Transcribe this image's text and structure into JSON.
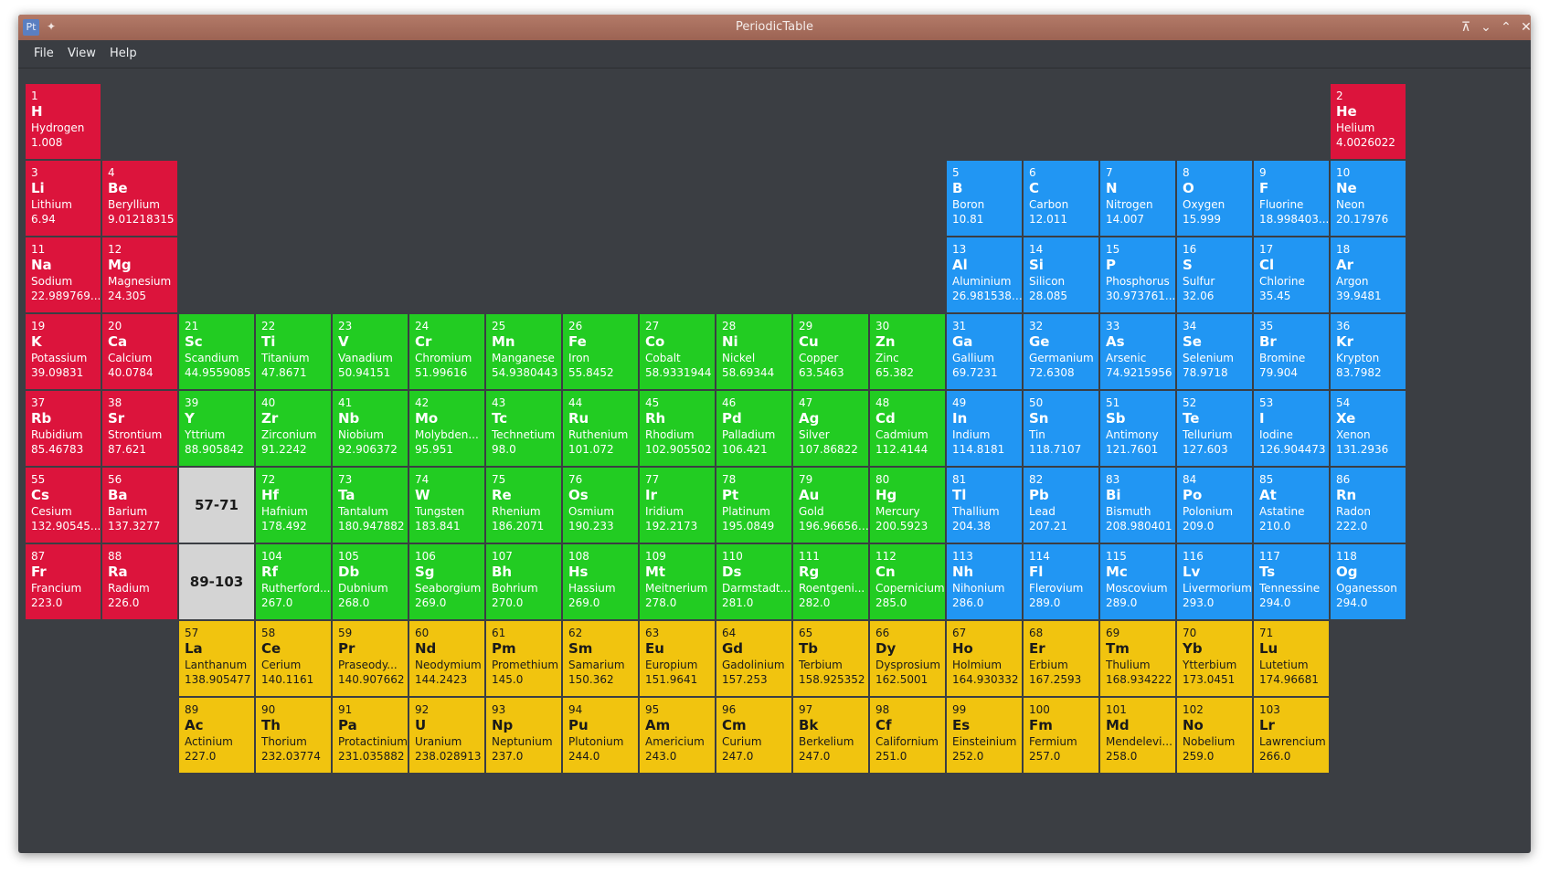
{
  "window": {
    "title": "PeriodicTable",
    "app_icon": "Pt",
    "controls": [
      "keep-above-icon",
      "minimize-icon",
      "maximize-icon",
      "close-icon"
    ]
  },
  "menu": [
    "File",
    "View",
    "Help"
  ],
  "colors": {
    "alkali_group": "#dc143c",
    "transition": "#22cc22",
    "p_block": "#2196f3",
    "f_block": "#f1c40f",
    "placeholder": "#d4d4d4",
    "background": "#3b3e43"
  },
  "placeholders": [
    {
      "label": "57-71",
      "row": 6,
      "col": 3
    },
    {
      "label": "89-103",
      "row": 7,
      "col": 3
    }
  ],
  "elements": [
    {
      "n": "1",
      "s": "H",
      "name": "Hydrogen",
      "m": "1.008",
      "row": 1,
      "col": 1,
      "cat": "alkali"
    },
    {
      "n": "2",
      "s": "He",
      "name": "Helium",
      "m": "4.0026022",
      "row": 1,
      "col": 18,
      "cat": "alkali"
    },
    {
      "n": "3",
      "s": "Li",
      "name": "Lithium",
      "m": "6.94",
      "row": 2,
      "col": 1,
      "cat": "alkali"
    },
    {
      "n": "4",
      "s": "Be",
      "name": "Beryllium",
      "m": "9.01218315",
      "row": 2,
      "col": 2,
      "cat": "alkali"
    },
    {
      "n": "5",
      "s": "B",
      "name": "Boron",
      "m": "10.81",
      "row": 2,
      "col": 13,
      "cat": "pblock"
    },
    {
      "n": "6",
      "s": "C",
      "name": "Carbon",
      "m": "12.011",
      "row": 2,
      "col": 14,
      "cat": "pblock"
    },
    {
      "n": "7",
      "s": "N",
      "name": "Nitrogen",
      "m": "14.007",
      "row": 2,
      "col": 15,
      "cat": "pblock"
    },
    {
      "n": "8",
      "s": "O",
      "name": "Oxygen",
      "m": "15.999",
      "row": 2,
      "col": 16,
      "cat": "pblock"
    },
    {
      "n": "9",
      "s": "F",
      "name": "Fluorine",
      "m": "18.998403...",
      "row": 2,
      "col": 17,
      "cat": "pblock"
    },
    {
      "n": "10",
      "s": "Ne",
      "name": "Neon",
      "m": "20.17976",
      "row": 2,
      "col": 18,
      "cat": "pblock"
    },
    {
      "n": "11",
      "s": "Na",
      "name": "Sodium",
      "m": "22.989769...",
      "row": 3,
      "col": 1,
      "cat": "alkali"
    },
    {
      "n": "12",
      "s": "Mg",
      "name": "Magnesium",
      "m": "24.305",
      "row": 3,
      "col": 2,
      "cat": "alkali"
    },
    {
      "n": "13",
      "s": "Al",
      "name": "Aluminium",
      "m": "26.98153857",
      "row": 3,
      "col": 13,
      "cat": "pblock"
    },
    {
      "n": "14",
      "s": "Si",
      "name": "Silicon",
      "m": "28.085",
      "row": 3,
      "col": 14,
      "cat": "pblock"
    },
    {
      "n": "15",
      "s": "P",
      "name": "Phosphorus",
      "m": "30.973761...",
      "row": 3,
      "col": 15,
      "cat": "pblock"
    },
    {
      "n": "16",
      "s": "S",
      "name": "Sulfur",
      "m": "32.06",
      "row": 3,
      "col": 16,
      "cat": "pblock"
    },
    {
      "n": "17",
      "s": "Cl",
      "name": "Chlorine",
      "m": "35.45",
      "row": 3,
      "col": 17,
      "cat": "pblock"
    },
    {
      "n": "18",
      "s": "Ar",
      "name": "Argon",
      "m": "39.9481",
      "row": 3,
      "col": 18,
      "cat": "pblock"
    },
    {
      "n": "19",
      "s": "K",
      "name": "Potassium",
      "m": "39.09831",
      "row": 4,
      "col": 1,
      "cat": "alkali"
    },
    {
      "n": "20",
      "s": "Ca",
      "name": "Calcium",
      "m": "40.0784",
      "row": 4,
      "col": 2,
      "cat": "alkali"
    },
    {
      "n": "21",
      "s": "Sc",
      "name": "Scandium",
      "m": "44.9559085",
      "row": 4,
      "col": 3,
      "cat": "trans"
    },
    {
      "n": "22",
      "s": "Ti",
      "name": "Titanium",
      "m": "47.8671",
      "row": 4,
      "col": 4,
      "cat": "trans"
    },
    {
      "n": "23",
      "s": "V",
      "name": "Vanadium",
      "m": "50.94151",
      "row": 4,
      "col": 5,
      "cat": "trans"
    },
    {
      "n": "24",
      "s": "Cr",
      "name": "Chromium",
      "m": "51.99616",
      "row": 4,
      "col": 6,
      "cat": "trans"
    },
    {
      "n": "25",
      "s": "Mn",
      "name": "Manganese",
      "m": "54.9380443",
      "row": 4,
      "col": 7,
      "cat": "trans"
    },
    {
      "n": "26",
      "s": "Fe",
      "name": "Iron",
      "m": "55.8452",
      "row": 4,
      "col": 8,
      "cat": "trans"
    },
    {
      "n": "27",
      "s": "Co",
      "name": "Cobalt",
      "m": "58.9331944",
      "row": 4,
      "col": 9,
      "cat": "trans"
    },
    {
      "n": "28",
      "s": "Ni",
      "name": "Nickel",
      "m": "58.69344",
      "row": 4,
      "col": 10,
      "cat": "trans"
    },
    {
      "n": "29",
      "s": "Cu",
      "name": "Copper",
      "m": "63.5463",
      "row": 4,
      "col": 11,
      "cat": "trans"
    },
    {
      "n": "30",
      "s": "Zn",
      "name": "Zinc",
      "m": "65.382",
      "row": 4,
      "col": 12,
      "cat": "trans"
    },
    {
      "n": "31",
      "s": "Ga",
      "name": "Gallium",
      "m": "69.7231",
      "row": 4,
      "col": 13,
      "cat": "pblock"
    },
    {
      "n": "32",
      "s": "Ge",
      "name": "Germanium",
      "m": "72.6308",
      "row": 4,
      "col": 14,
      "cat": "pblock"
    },
    {
      "n": "33",
      "s": "As",
      "name": "Arsenic",
      "m": "74.9215956",
      "row": 4,
      "col": 15,
      "cat": "pblock"
    },
    {
      "n": "34",
      "s": "Se",
      "name": "Selenium",
      "m": "78.9718",
      "row": 4,
      "col": 16,
      "cat": "pblock"
    },
    {
      "n": "35",
      "s": "Br",
      "name": "Bromine",
      "m": "79.904",
      "row": 4,
      "col": 17,
      "cat": "pblock"
    },
    {
      "n": "36",
      "s": "Kr",
      "name": "Krypton",
      "m": "83.7982",
      "row": 4,
      "col": 18,
      "cat": "pblock"
    },
    {
      "n": "37",
      "s": "Rb",
      "name": "Rubidium",
      "m": "85.46783",
      "row": 5,
      "col": 1,
      "cat": "alkali"
    },
    {
      "n": "38",
      "s": "Sr",
      "name": "Strontium",
      "m": "87.621",
      "row": 5,
      "col": 2,
      "cat": "alkali"
    },
    {
      "n": "39",
      "s": "Y",
      "name": "Yttrium",
      "m": "88.905842",
      "row": 5,
      "col": 3,
      "cat": "trans"
    },
    {
      "n": "40",
      "s": "Zr",
      "name": "Zirconium",
      "m": "91.2242",
      "row": 5,
      "col": 4,
      "cat": "trans"
    },
    {
      "n": "41",
      "s": "Nb",
      "name": "Niobium",
      "m": "92.906372",
      "row": 5,
      "col": 5,
      "cat": "trans"
    },
    {
      "n": "42",
      "s": "Mo",
      "name": "Molybden...",
      "m": "95.951",
      "row": 5,
      "col": 6,
      "cat": "trans"
    },
    {
      "n": "43",
      "s": "Tc",
      "name": "Technetium",
      "m": "98.0",
      "row": 5,
      "col": 7,
      "cat": "trans"
    },
    {
      "n": "44",
      "s": "Ru",
      "name": "Ruthenium",
      "m": "101.072",
      "row": 5,
      "col": 8,
      "cat": "trans"
    },
    {
      "n": "45",
      "s": "Rh",
      "name": "Rhodium",
      "m": "102.905502",
      "row": 5,
      "col": 9,
      "cat": "trans"
    },
    {
      "n": "46",
      "s": "Pd",
      "name": "Palladium",
      "m": "106.421",
      "row": 5,
      "col": 10,
      "cat": "trans"
    },
    {
      "n": "47",
      "s": "Ag",
      "name": "Silver",
      "m": "107.86822",
      "row": 5,
      "col": 11,
      "cat": "trans"
    },
    {
      "n": "48",
      "s": "Cd",
      "name": "Cadmium",
      "m": "112.4144",
      "row": 5,
      "col": 12,
      "cat": "trans"
    },
    {
      "n": "49",
      "s": "In",
      "name": "Indium",
      "m": "114.8181",
      "row": 5,
      "col": 13,
      "cat": "pblock"
    },
    {
      "n": "50",
      "s": "Sn",
      "name": "Tin",
      "m": "118.7107",
      "row": 5,
      "col": 14,
      "cat": "pblock"
    },
    {
      "n": "51",
      "s": "Sb",
      "name": "Antimony",
      "m": "121.7601",
      "row": 5,
      "col": 15,
      "cat": "pblock"
    },
    {
      "n": "52",
      "s": "Te",
      "name": "Tellurium",
      "m": "127.603",
      "row": 5,
      "col": 16,
      "cat": "pblock"
    },
    {
      "n": "53",
      "s": "I",
      "name": "Iodine",
      "m": "126.904473",
      "row": 5,
      "col": 17,
      "cat": "pblock"
    },
    {
      "n": "54",
      "s": "Xe",
      "name": "Xenon",
      "m": "131.2936",
      "row": 5,
      "col": 18,
      "cat": "pblock"
    },
    {
      "n": "55",
      "s": "Cs",
      "name": "Cesium",
      "m": "132.90545...",
      "row": 6,
      "col": 1,
      "cat": "alkali"
    },
    {
      "n": "56",
      "s": "Ba",
      "name": "Barium",
      "m": "137.3277",
      "row": 6,
      "col": 2,
      "cat": "alkali"
    },
    {
      "n": "72",
      "s": "Hf",
      "name": "Hafnium",
      "m": "178.492",
      "row": 6,
      "col": 4,
      "cat": "trans"
    },
    {
      "n": "73",
      "s": "Ta",
      "name": "Tantalum",
      "m": "180.947882",
      "row": 6,
      "col": 5,
      "cat": "trans"
    },
    {
      "n": "74",
      "s": "W",
      "name": "Tungsten",
      "m": "183.841",
      "row": 6,
      "col": 6,
      "cat": "trans"
    },
    {
      "n": "75",
      "s": "Re",
      "name": "Rhenium",
      "m": "186.2071",
      "row": 6,
      "col": 7,
      "cat": "trans"
    },
    {
      "n": "76",
      "s": "Os",
      "name": "Osmium",
      "m": "190.233",
      "row": 6,
      "col": 8,
      "cat": "trans"
    },
    {
      "n": "77",
      "s": "Ir",
      "name": "Iridium",
      "m": "192.2173",
      "row": 6,
      "col": 9,
      "cat": "trans"
    },
    {
      "n": "78",
      "s": "Pt",
      "name": "Platinum",
      "m": "195.0849",
      "row": 6,
      "col": 10,
      "cat": "trans"
    },
    {
      "n": "79",
      "s": "Au",
      "name": "Gold",
      "m": "196.9665695",
      "row": 6,
      "col": 11,
      "cat": "trans"
    },
    {
      "n": "80",
      "s": "Hg",
      "name": "Mercury",
      "m": "200.5923",
      "row": 6,
      "col": 12,
      "cat": "trans"
    },
    {
      "n": "81",
      "s": "Tl",
      "name": "Thallium",
      "m": "204.38",
      "row": 6,
      "col": 13,
      "cat": "pblock"
    },
    {
      "n": "82",
      "s": "Pb",
      "name": "Lead",
      "m": "207.21",
      "row": 6,
      "col": 14,
      "cat": "pblock"
    },
    {
      "n": "83",
      "s": "Bi",
      "name": "Bismuth",
      "m": "208.980401",
      "row": 6,
      "col": 15,
      "cat": "pblock"
    },
    {
      "n": "84",
      "s": "Po",
      "name": "Polonium",
      "m": "209.0",
      "row": 6,
      "col": 16,
      "cat": "pblock"
    },
    {
      "n": "85",
      "s": "At",
      "name": "Astatine",
      "m": "210.0",
      "row": 6,
      "col": 17,
      "cat": "pblock"
    },
    {
      "n": "86",
      "s": "Rn",
      "name": "Radon",
      "m": "222.0",
      "row": 6,
      "col": 18,
      "cat": "pblock"
    },
    {
      "n": "87",
      "s": "Fr",
      "name": "Francium",
      "m": "223.0",
      "row": 7,
      "col": 1,
      "cat": "alkali"
    },
    {
      "n": "88",
      "s": "Ra",
      "name": "Radium",
      "m": "226.0",
      "row": 7,
      "col": 2,
      "cat": "alkali"
    },
    {
      "n": "104",
      "s": "Rf",
      "name": "Rutherford...",
      "m": "267.0",
      "row": 7,
      "col": 4,
      "cat": "trans"
    },
    {
      "n": "105",
      "s": "Db",
      "name": "Dubnium",
      "m": "268.0",
      "row": 7,
      "col": 5,
      "cat": "trans"
    },
    {
      "n": "106",
      "s": "Sg",
      "name": "Seaborgium",
      "m": "269.0",
      "row": 7,
      "col": 6,
      "cat": "trans"
    },
    {
      "n": "107",
      "s": "Bh",
      "name": "Bohrium",
      "m": "270.0",
      "row": 7,
      "col": 7,
      "cat": "trans"
    },
    {
      "n": "108",
      "s": "Hs",
      "name": "Hassium",
      "m": "269.0",
      "row": 7,
      "col": 8,
      "cat": "trans"
    },
    {
      "n": "109",
      "s": "Mt",
      "name": "Meitnerium",
      "m": "278.0",
      "row": 7,
      "col": 9,
      "cat": "trans"
    },
    {
      "n": "110",
      "s": "Ds",
      "name": "Darmstadt...",
      "m": "281.0",
      "row": 7,
      "col": 10,
      "cat": "trans"
    },
    {
      "n": "111",
      "s": "Rg",
      "name": "Roentgeni...",
      "m": "282.0",
      "row": 7,
      "col": 11,
      "cat": "trans"
    },
    {
      "n": "112",
      "s": "Cn",
      "name": "Copernicium",
      "m": "285.0",
      "row": 7,
      "col": 12,
      "cat": "trans"
    },
    {
      "n": "113",
      "s": "Nh",
      "name": "Nihonium",
      "m": "286.0",
      "row": 7,
      "col": 13,
      "cat": "pblock"
    },
    {
      "n": "114",
      "s": "Fl",
      "name": "Flerovium",
      "m": "289.0",
      "row": 7,
      "col": 14,
      "cat": "pblock"
    },
    {
      "n": "115",
      "s": "Mc",
      "name": "Moscovium",
      "m": "289.0",
      "row": 7,
      "col": 15,
      "cat": "pblock"
    },
    {
      "n": "116",
      "s": "Lv",
      "name": "Livermorium",
      "m": "293.0",
      "row": 7,
      "col": 16,
      "cat": "pblock"
    },
    {
      "n": "117",
      "s": "Ts",
      "name": "Tennessine",
      "m": "294.0",
      "row": 7,
      "col": 17,
      "cat": "pblock"
    },
    {
      "n": "118",
      "s": "Og",
      "name": "Oganesson",
      "m": "294.0",
      "row": 7,
      "col": 18,
      "cat": "pblock"
    },
    {
      "n": "57",
      "s": "La",
      "name": "Lanthanum",
      "m": "138.905477",
      "row": 8,
      "col": 3,
      "cat": "fblock"
    },
    {
      "n": "58",
      "s": "Ce",
      "name": "Cerium",
      "m": "140.1161",
      "row": 8,
      "col": 4,
      "cat": "fblock"
    },
    {
      "n": "59",
      "s": "Pr",
      "name": "Praseody...",
      "m": "140.907662",
      "row": 8,
      "col": 5,
      "cat": "fblock"
    },
    {
      "n": "60",
      "s": "Nd",
      "name": "Neodymium",
      "m": "144.2423",
      "row": 8,
      "col": 6,
      "cat": "fblock"
    },
    {
      "n": "61",
      "s": "Pm",
      "name": "Promethium",
      "m": "145.0",
      "row": 8,
      "col": 7,
      "cat": "fblock"
    },
    {
      "n": "62",
      "s": "Sm",
      "name": "Samarium",
      "m": "150.362",
      "row": 8,
      "col": 8,
      "cat": "fblock"
    },
    {
      "n": "63",
      "s": "Eu",
      "name": "Europium",
      "m": "151.9641",
      "row": 8,
      "col": 9,
      "cat": "fblock"
    },
    {
      "n": "64",
      "s": "Gd",
      "name": "Gadolinium",
      "m": "157.253",
      "row": 8,
      "col": 10,
      "cat": "fblock"
    },
    {
      "n": "65",
      "s": "Tb",
      "name": "Terbium",
      "m": "158.925352",
      "row": 8,
      "col": 11,
      "cat": "fblock"
    },
    {
      "n": "66",
      "s": "Dy",
      "name": "Dysprosium",
      "m": "162.5001",
      "row": 8,
      "col": 12,
      "cat": "fblock"
    },
    {
      "n": "67",
      "s": "Ho",
      "name": "Holmium",
      "m": "164.930332",
      "row": 8,
      "col": 13,
      "cat": "fblock"
    },
    {
      "n": "68",
      "s": "Er",
      "name": "Erbium",
      "m": "167.2593",
      "row": 8,
      "col": 14,
      "cat": "fblock"
    },
    {
      "n": "69",
      "s": "Tm",
      "name": "Thulium",
      "m": "168.934222",
      "row": 8,
      "col": 15,
      "cat": "fblock"
    },
    {
      "n": "70",
      "s": "Yb",
      "name": "Ytterbium",
      "m": "173.0451",
      "row": 8,
      "col": 16,
      "cat": "fblock"
    },
    {
      "n": "71",
      "s": "Lu",
      "name": "Lutetium",
      "m": "174.96681",
      "row": 8,
      "col": 17,
      "cat": "fblock"
    },
    {
      "n": "89",
      "s": "Ac",
      "name": "Actinium",
      "m": "227.0",
      "row": 9,
      "col": 3,
      "cat": "fblock"
    },
    {
      "n": "90",
      "s": "Th",
      "name": "Thorium",
      "m": "232.03774",
      "row": 9,
      "col": 4,
      "cat": "fblock"
    },
    {
      "n": "91",
      "s": "Pa",
      "name": "Protactinium",
      "m": "231.035882",
      "row": 9,
      "col": 5,
      "cat": "fblock"
    },
    {
      "n": "92",
      "s": "U",
      "name": "Uranium",
      "m": "238.028913",
      "row": 9,
      "col": 6,
      "cat": "fblock"
    },
    {
      "n": "93",
      "s": "Np",
      "name": "Neptunium",
      "m": "237.0",
      "row": 9,
      "col": 7,
      "cat": "fblock"
    },
    {
      "n": "94",
      "s": "Pu",
      "name": "Plutonium",
      "m": "244.0",
      "row": 9,
      "col": 8,
      "cat": "fblock"
    },
    {
      "n": "95",
      "s": "Am",
      "name": "Americium",
      "m": "243.0",
      "row": 9,
      "col": 9,
      "cat": "fblock"
    },
    {
      "n": "96",
      "s": "Cm",
      "name": "Curium",
      "m": "247.0",
      "row": 9,
      "col": 10,
      "cat": "fblock"
    },
    {
      "n": "97",
      "s": "Bk",
      "name": "Berkelium",
      "m": "247.0",
      "row": 9,
      "col": 11,
      "cat": "fblock"
    },
    {
      "n": "98",
      "s": "Cf",
      "name": "Californium",
      "m": "251.0",
      "row": 9,
      "col": 12,
      "cat": "fblock"
    },
    {
      "n": "99",
      "s": "Es",
      "name": "Einsteinium",
      "m": "252.0",
      "row": 9,
      "col": 13,
      "cat": "fblock"
    },
    {
      "n": "100",
      "s": "Fm",
      "name": "Fermium",
      "m": "257.0",
      "row": 9,
      "col": 14,
      "cat": "fblock"
    },
    {
      "n": "101",
      "s": "Md",
      "name": "Mendelevi...",
      "m": "258.0",
      "row": 9,
      "col": 15,
      "cat": "fblock"
    },
    {
      "n": "102",
      "s": "No",
      "name": "Nobelium",
      "m": "259.0",
      "row": 9,
      "col": 16,
      "cat": "fblock"
    },
    {
      "n": "103",
      "s": "Lr",
      "name": "Lawrencium",
      "m": "266.0",
      "row": 9,
      "col": 17,
      "cat": "fblock"
    }
  ]
}
